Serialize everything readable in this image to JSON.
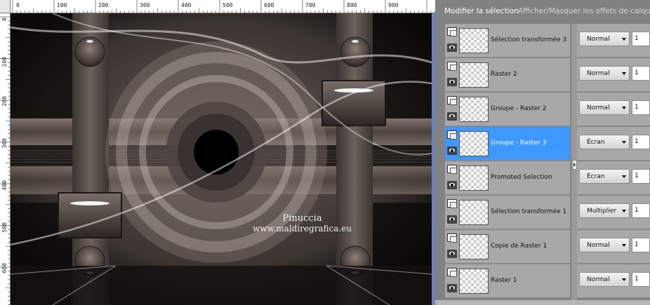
{
  "menu": {
    "modify_selection": "Modifier la sélection",
    "show_hide_effects": "Afficher/Masquer les effets de calque"
  },
  "ruler": {
    "top_labels": [
      "0",
      "100",
      "200",
      "300",
      "400",
      "500",
      "600",
      "700",
      "800",
      "900"
    ],
    "left_labels": [
      "0",
      "100",
      "200",
      "300",
      "400",
      "500",
      "600"
    ]
  },
  "watermark": {
    "line1": "Pinuccia",
    "line2": "www.maldiregrafica.eu"
  },
  "layers": [
    {
      "name": "Sélection transformée 3",
      "blend": "Normal",
      "opacity": "1",
      "selected": false
    },
    {
      "name": "Raster 2",
      "blend": "Normal",
      "opacity": "1",
      "selected": false
    },
    {
      "name": "Groupe - Raster 2",
      "blend": "Normal",
      "opacity": "1",
      "selected": false
    },
    {
      "name": "Groupe - Raster 3",
      "blend": "Écran",
      "opacity": "1",
      "selected": true
    },
    {
      "name": "Promoted Selection",
      "blend": "Écran",
      "opacity": "1",
      "selected": false
    },
    {
      "name": "Sélection transformée 1",
      "blend": "Multiplier",
      "opacity": "1",
      "selected": false
    },
    {
      "name": "Copie de Raster 1",
      "blend": "Normal",
      "opacity": "1",
      "selected": false
    },
    {
      "name": "Raster 1",
      "blend": "Normal",
      "opacity": "1",
      "selected": false
    }
  ],
  "colors": {
    "selected_layer": "#3d98ff",
    "panel_bg": "#828282",
    "row_bg": "#a8a8a8"
  }
}
